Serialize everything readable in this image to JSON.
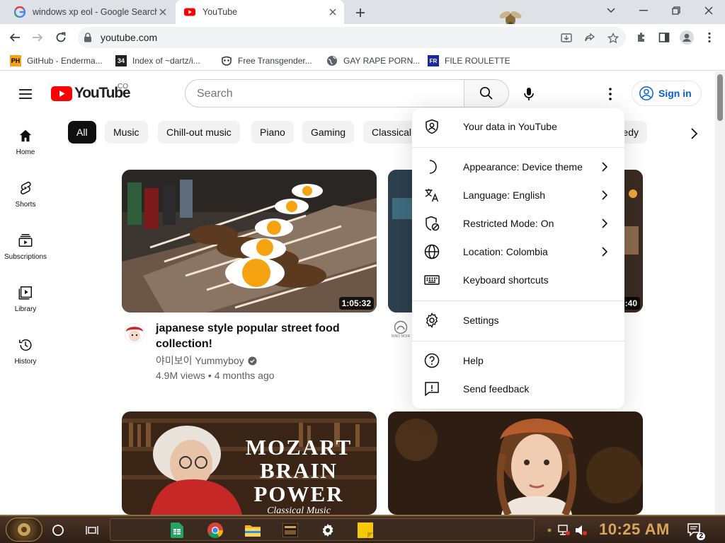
{
  "browser": {
    "tabs": [
      {
        "title": "windows xp eol - Google Search",
        "active": false
      },
      {
        "title": "YouTube",
        "active": true
      }
    ],
    "url": "youtube.com",
    "bookmarks": [
      {
        "label": "GitHub - Enderma..."
      },
      {
        "label": "Index of ~dartz/i..."
      },
      {
        "label": "Free Transgender..."
      },
      {
        "label": "GAY RAPE PORN..."
      },
      {
        "label": "FILE ROULETTE"
      }
    ],
    "bookmark_badges": {
      "github": "PH",
      "index": "34",
      "roulette": "FR"
    }
  },
  "youtube": {
    "logo_text": "YouTube",
    "country_code": "CO",
    "search_placeholder": "Search",
    "sign_in": "Sign in",
    "side_nav": [
      {
        "label": "Home"
      },
      {
        "label": "Shorts"
      },
      {
        "label": "Subscriptions"
      },
      {
        "label": "Library"
      },
      {
        "label": "History"
      }
    ],
    "chips": [
      "All",
      "Music",
      "Chill-out music",
      "Piano",
      "Gaming",
      "Classical",
      "edy"
    ],
    "videos": [
      {
        "title_line1": "japanese style popular street food",
        "title_line2": "collection!",
        "channel": "야미보이 Yummyboy",
        "meta": "4.9M views • 4 months ago",
        "duration": "1:05:32"
      },
      {
        "duration": ":40",
        "channel_logo_text": "NINO NOIR"
      },
      {
        "thumb_text_line1": "MOZART",
        "thumb_text_line2": "BRAIN",
        "thumb_text_line3": "POWER",
        "thumb_text_line4": "Classical Music"
      },
      {}
    ],
    "menu": [
      {
        "label": "Your data in YouTube",
        "icon": "shield-person-icon",
        "arrow": false
      },
      {
        "label": "Appearance: Device theme",
        "icon": "moon-icon",
        "arrow": true
      },
      {
        "label": "Language: English",
        "icon": "translate-icon",
        "arrow": true
      },
      {
        "label": "Restricted Mode: On",
        "icon": "restricted-icon",
        "arrow": true
      },
      {
        "label": "Location: Colombia",
        "icon": "globe-icon",
        "arrow": true
      },
      {
        "label": "Keyboard shortcuts",
        "icon": "keyboard-icon",
        "arrow": false
      },
      {
        "label": "Settings",
        "icon": "gear-icon",
        "arrow": false
      },
      {
        "label": "Help",
        "icon": "help-icon",
        "arrow": false
      },
      {
        "label": "Send feedback",
        "icon": "feedback-icon",
        "arrow": false
      }
    ]
  },
  "taskbar": {
    "clock": "10:25 AM",
    "notification_count": "2"
  },
  "colors": {
    "youtube_red": "#ff0000",
    "link_blue": "#065fd4",
    "chrome_frame": "#dee1e6",
    "taskbar": "#3a281c"
  }
}
